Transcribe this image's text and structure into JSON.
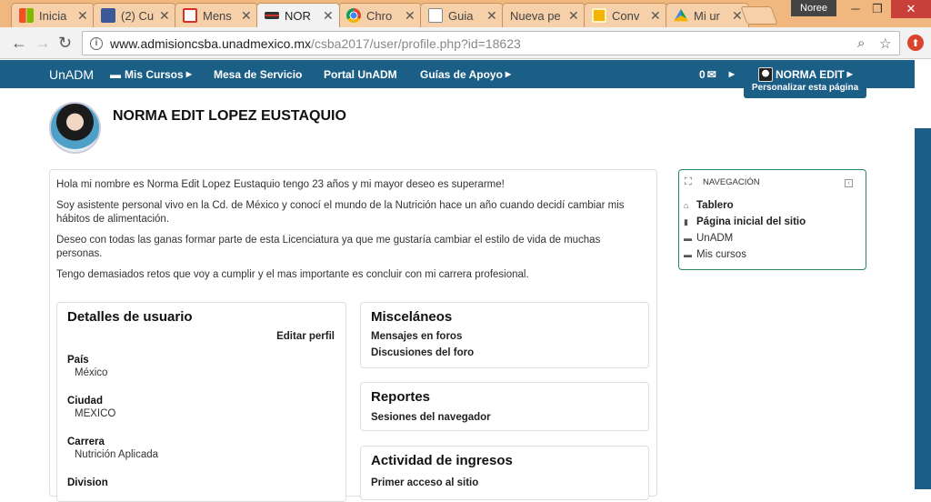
{
  "browser": {
    "tabs": [
      {
        "title": "Inicia",
        "icon": "windows-icon"
      },
      {
        "title": "(2) Cu",
        "icon": "facebook-icon"
      },
      {
        "title": "Mens",
        "icon": "gmail-icon"
      },
      {
        "title": "NOR",
        "icon": "unadm-icon"
      },
      {
        "title": "Chro",
        "icon": "chrome-icon"
      },
      {
        "title": "Guia",
        "icon": "document-icon"
      },
      {
        "title": "Nueva pe",
        "icon": ""
      },
      {
        "title": "Conv",
        "icon": "slides-icon"
      },
      {
        "title": "Mi ur",
        "icon": "drive-icon"
      }
    ],
    "profile_name": "Noree",
    "url_domain": "www.admisioncsba.unadmexico.mx",
    "url_path": "/csba2017/user/profile.php?id=18623"
  },
  "sitenav": {
    "brand": "UnADM",
    "mis_cursos": "Mis Cursos",
    "mesa": "Mesa de Servicio",
    "portal": "Portal UnADM",
    "guias": "Guías de Apoyo",
    "messages": "0",
    "user": "NORMA EDIT",
    "customize": "Personalizar esta página"
  },
  "profile": {
    "name": "NORMA EDIT LOPEZ EUSTAQUIO",
    "description": [
      "Hola mi nombre es Norma Edit Lopez Eustaquio tengo 23 años y mi mayor deseo es superarme!",
      "Soy asistente personal vivo en la Cd. de México y conocí el mundo de la Nutrición hace un año cuando decidí cambiar mis hábitos de alimentación.",
      "Deseo con todas las ganas formar parte de esta Licenciatura ya que me gustaría cambiar el estilo de vida de muchas personas.",
      "Tengo demasiados retos que voy a cumplir y el mas importante es concluir con mi carrera profesional."
    ]
  },
  "details": {
    "title": "Detalles de usuario",
    "edit": "Editar perfil",
    "country_label": "País",
    "country": "México",
    "city_label": "Ciudad",
    "city": "MEXICO",
    "career_label": "Carrera",
    "career": "Nutrición Aplicada",
    "division_label": "Division"
  },
  "misc": {
    "title": "Misceláneos",
    "forum_posts": "Mensajes en foros",
    "forum_discussions": "Discusiones del foro"
  },
  "reports": {
    "title": "Reportes",
    "sessions": "Sesiones del navegador"
  },
  "activity": {
    "title": "Actividad de ingresos",
    "first_access": "Primer acceso al sitio"
  },
  "navigation": {
    "header": "NAVEGACIÓN",
    "items": [
      "Tablero",
      "Página inicial del sitio",
      "UnADM",
      "Mis cursos"
    ]
  }
}
